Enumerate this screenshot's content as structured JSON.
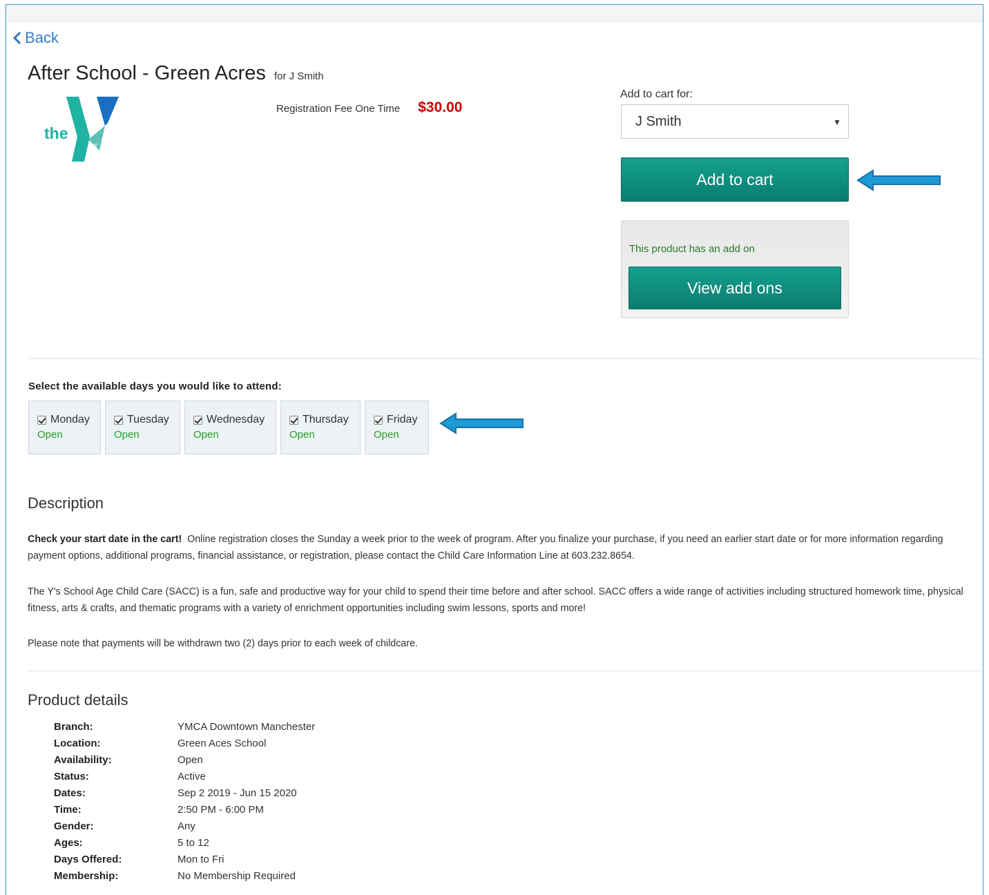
{
  "nav": {
    "back_label": "Back"
  },
  "product": {
    "title": "After School - Green Acres",
    "for_label": "for J Smith",
    "fee_label": "Registration Fee One Time",
    "price": "$30.00",
    "logo_text": "the"
  },
  "cart": {
    "for_label": "Add to cart for:",
    "selected_person": "J Smith",
    "add_button": "Add to cart"
  },
  "addons": {
    "message": "This product has an add on",
    "view_button": "View add ons"
  },
  "days": {
    "prompt": "Select the available days you would like to attend:",
    "items": [
      {
        "name": "Monday",
        "status": "Open",
        "checked": true
      },
      {
        "name": "Tuesday",
        "status": "Open",
        "checked": true
      },
      {
        "name": "Wednesday",
        "status": "Open",
        "checked": true
      },
      {
        "name": "Thursday",
        "status": "Open",
        "checked": true
      },
      {
        "name": "Friday",
        "status": "Open",
        "checked": true
      }
    ]
  },
  "description": {
    "heading": "Description",
    "p1_bold": "Check your start date in the cart!",
    "p1_rest": "Online registration closes the Sunday a week prior to the week of program.  After you finalize your purchase, if you need an earlier start date or for more information regarding payment options, additional programs, financial assistance, or registration, please contact the Child Care Information Line at 603.232.8654.",
    "p2": "The Y's School Age Child Care (SACC) is a fun, safe and productive way for your child to spend their time before and after school.  SACC offers a wide range of activities including structured homework time, physical fitness, arts & crafts, and thematic programs with a variety of enrichment opportunities including swim lessons, sports and more!",
    "p3": "Please note that payments will be withdrawn two (2) days prior to each week of childcare."
  },
  "details": {
    "heading": "Product details",
    "rows": [
      {
        "key": "Branch:",
        "value": "YMCA Downtown Manchester"
      },
      {
        "key": "Location:",
        "value": "Green Aces School"
      },
      {
        "key": "Availability:",
        "value": "Open"
      },
      {
        "key": "Status:",
        "value": "Active"
      },
      {
        "key": "Dates:",
        "value": "Sep 2 2019 - Jun 15 2020"
      },
      {
        "key": "Time:",
        "value": "2:50 PM - 6:00 PM"
      },
      {
        "key": "Gender:",
        "value": "Any"
      },
      {
        "key": "Ages:",
        "value": "5 to 12"
      },
      {
        "key": "Days Offered:",
        "value": "Mon to Fri"
      },
      {
        "key": "Membership:",
        "value": "No Membership Required"
      }
    ]
  },
  "colors": {
    "teal_button": "#0f8f80",
    "price_red": "#cc0000",
    "open_green": "#22a322",
    "arrow_blue": "#1c9bd6"
  }
}
